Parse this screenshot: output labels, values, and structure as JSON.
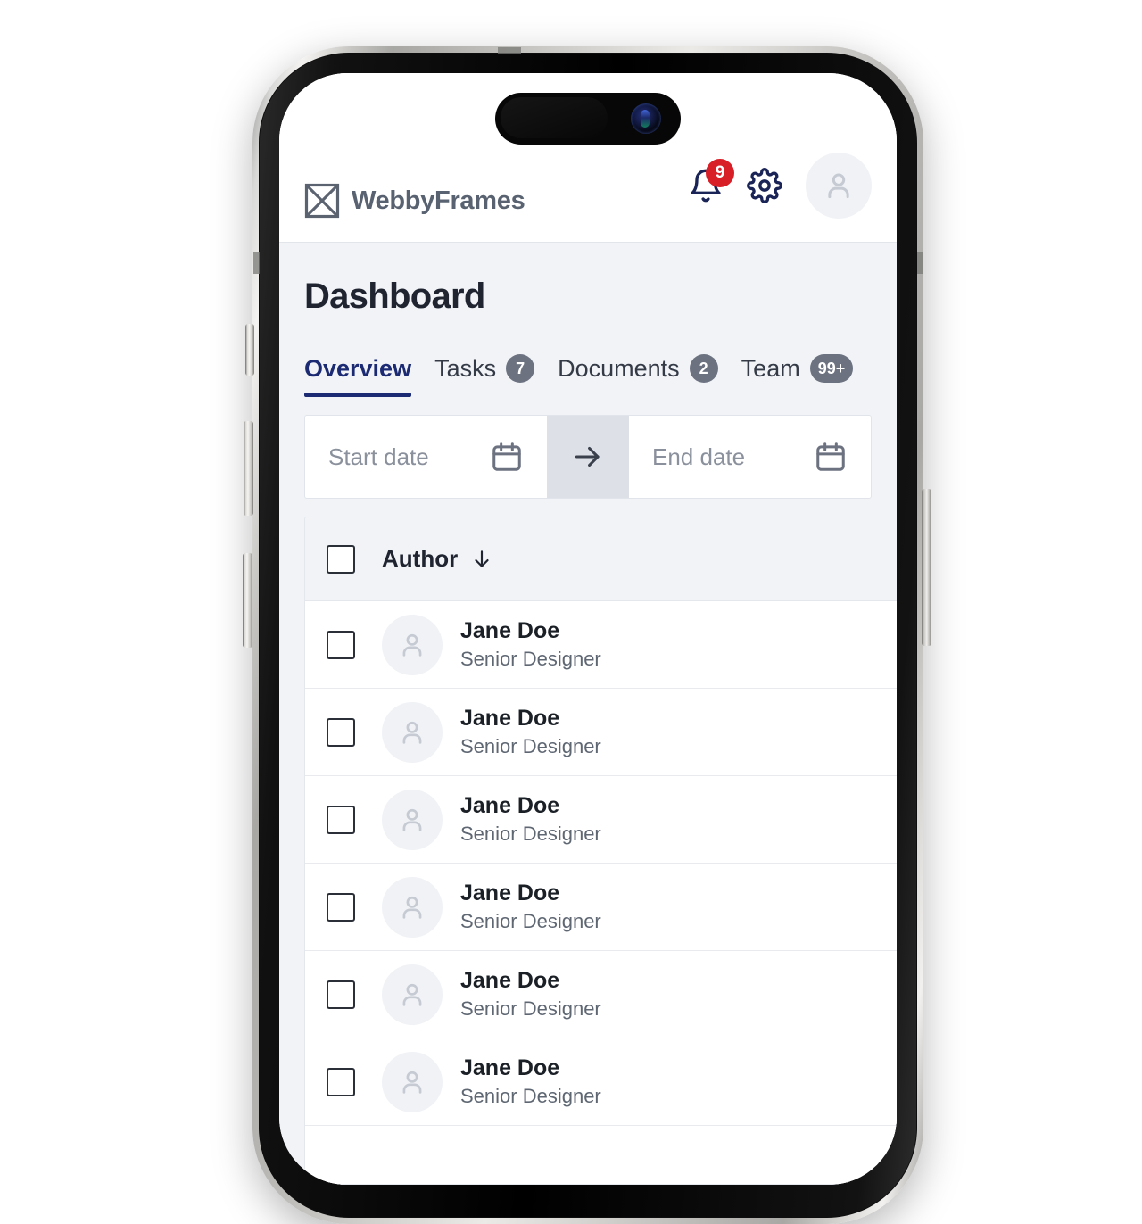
{
  "brand": {
    "name": "WebbyFrames",
    "logo_icon": "image-placeholder-x-icon"
  },
  "header": {
    "notifications": {
      "icon": "bell-icon",
      "badge_count": "9",
      "badge_color": "#d81f27"
    },
    "settings": {
      "icon": "gear-icon",
      "color": "#1a2456"
    },
    "account": {
      "icon": "user-avatar-icon"
    }
  },
  "page": {
    "title": "Dashboard"
  },
  "tabs": {
    "active_index": 0,
    "accent_color": "#1b2a73",
    "badge_color": "#6c7280",
    "items": [
      {
        "label": "Overview",
        "badge": ""
      },
      {
        "label": "Tasks",
        "badge": "7"
      },
      {
        "label": "Documents",
        "badge": "2"
      },
      {
        "label": "Team",
        "badge": "99+"
      }
    ]
  },
  "date_range": {
    "start_placeholder": "Start date",
    "start_value": "",
    "end_placeholder": "End date",
    "end_value": "",
    "start_icon": "calendar-icon",
    "end_icon": "calendar-icon",
    "separator_icon": "arrow-right-icon"
  },
  "table": {
    "columns": [
      {
        "key": "select",
        "label": ""
      },
      {
        "key": "author",
        "label": "Author",
        "sort": "descending",
        "sort_icon": "arrow-down-icon"
      }
    ],
    "rows": [
      {
        "name": "Jane Doe",
        "role": "Senior Designer",
        "selected": false,
        "avatar": "user-avatar-icon"
      },
      {
        "name": "Jane Doe",
        "role": "Senior Designer",
        "selected": false,
        "avatar": "user-avatar-icon"
      },
      {
        "name": "Jane Doe",
        "role": "Senior Designer",
        "selected": false,
        "avatar": "user-avatar-icon"
      },
      {
        "name": "Jane Doe",
        "role": "Senior Designer",
        "selected": false,
        "avatar": "user-avatar-icon"
      },
      {
        "name": "Jane Doe",
        "role": "Senior Designer",
        "selected": false,
        "avatar": "user-avatar-icon"
      },
      {
        "name": "Jane Doe",
        "role": "Senior Designer",
        "selected": false,
        "avatar": "user-avatar-icon"
      }
    ]
  },
  "device": {
    "notch": "dynamic-island",
    "camera": "front-camera-icon"
  }
}
